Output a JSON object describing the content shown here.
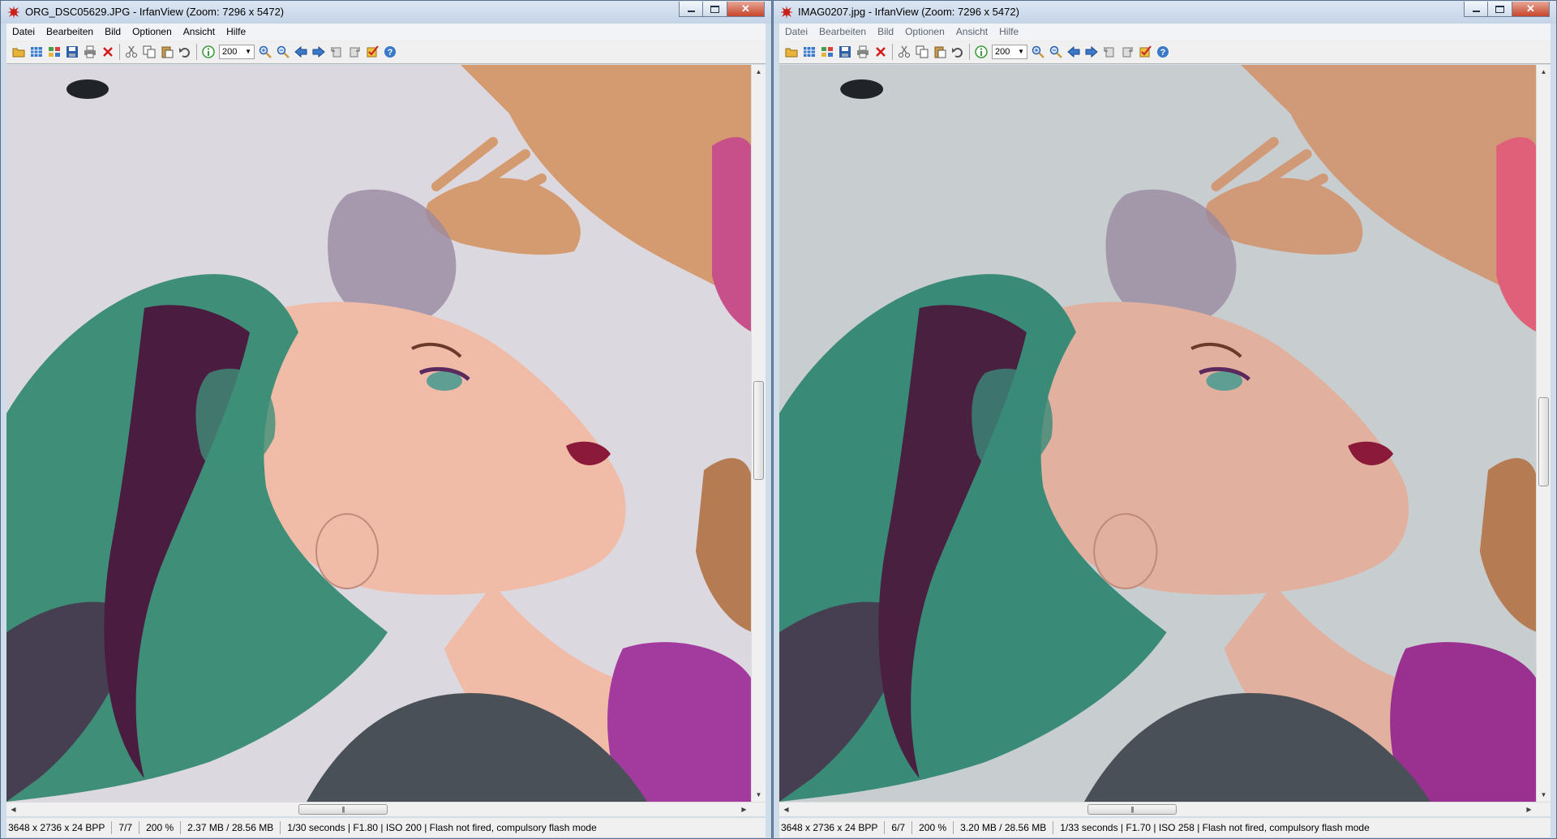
{
  "windows": {
    "left": {
      "title": "ORG_DSC05629.JPG - IrfanView (Zoom: 7296 x 5472)",
      "zoom_value": "200",
      "status": {
        "dimensions": "3648 x 2736 x 24 BPP",
        "index": "7/7",
        "zoom": "200 %",
        "size": "2.37 MB / 28.56 MB",
        "exif": "1/30 seconds  |  F1.80  |  ISO 200  |  Flash not fired, compulsory flash mode"
      }
    },
    "right": {
      "title": "IMAG0207.jpg - IrfanView (Zoom: 7296 x 5472)",
      "zoom_value": "200",
      "status": {
        "dimensions": "3648 x 2736 x 24 BPP",
        "index": "6/7",
        "zoom": "200 %",
        "size": "3.20 MB / 28.56 MB",
        "exif": "1/33 seconds  |  F1.70  |  ISO 258  |  Flash not fired, compulsory flash mode"
      }
    }
  },
  "menu": [
    "Datei",
    "Bearbeiten",
    "Bild",
    "Optionen",
    "Ansicht",
    "Hilfe"
  ],
  "toolbar_icons": [
    "open-icon",
    "thumbnails-icon",
    "slideshow-icon",
    "save-icon",
    "print-icon",
    "delete-icon",
    "cut-icon",
    "copy-icon",
    "paste-icon",
    "undo-icon",
    "info-icon",
    "zoom-in-icon",
    "zoom-out-icon",
    "previous-icon",
    "next-icon",
    "rotate-left-icon",
    "rotate-right-icon",
    "settings-icon",
    "help-icon"
  ],
  "colors": {
    "title_bar": "#c4d4e7",
    "close_button": "#c7452c",
    "hair_green": "#3f8f78",
    "hair_purple": "#4a1d40",
    "skin_left": "#f0bca8",
    "skin_right": "#e2b09e",
    "dress": "#a33a9e"
  }
}
